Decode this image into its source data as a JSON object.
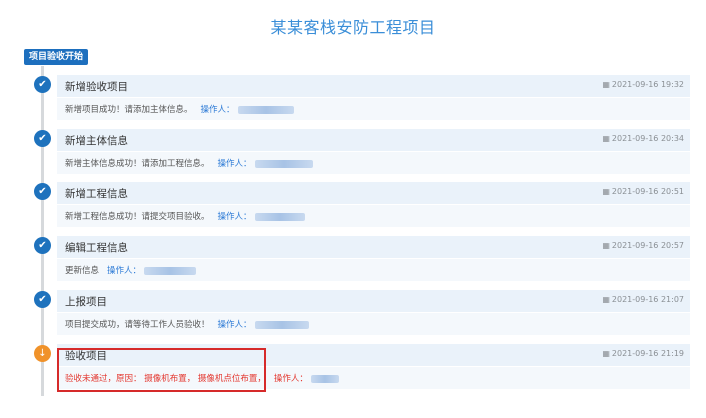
{
  "header": {
    "title": "某某客栈安防工程项目"
  },
  "timeline": {
    "start_label": "项目验收开始",
    "events": [
      {
        "title": "新增验收项目",
        "time": "2021-09-16 19:32",
        "description": "新增项目成功！请添加主体信息。",
        "operator_label": "操作人：",
        "status": "done"
      },
      {
        "title": "新增主体信息",
        "time": "2021-09-16 20:34",
        "description": "新增主体信息成功！请添加工程信息。",
        "operator_label": "操作人：",
        "status": "done"
      },
      {
        "title": "新增工程信息",
        "time": "2021-09-16 20:51",
        "description": "新增工程信息成功！请提交项目验收。",
        "operator_label": "操作人：",
        "status": "done"
      },
      {
        "title": "编辑工程信息",
        "time": "2021-09-16 20:57",
        "description": "更新信息",
        "operator_label": "操作人：",
        "status": "done"
      },
      {
        "title": "上报项目",
        "time": "2021-09-16 21:07",
        "description": "项目提交成功，请等待工作人员验收！",
        "operator_label": "操作人：",
        "status": "done"
      },
      {
        "title": "验收项目",
        "time": "2021-09-16 21:19",
        "description": "验收未通过，原因：  摄像机布置，  摄像机点位布置，",
        "operator_label": "操作人：",
        "status": "warning"
      }
    ]
  },
  "icons": {
    "done": "check-icon",
    "warning": "arrow-down-icon",
    "time": "calendar-icon"
  },
  "colors": {
    "accent": "#1e72bd",
    "warning": "#f0922a",
    "error": "#e3372f",
    "highlight": "#d62a2a"
  }
}
